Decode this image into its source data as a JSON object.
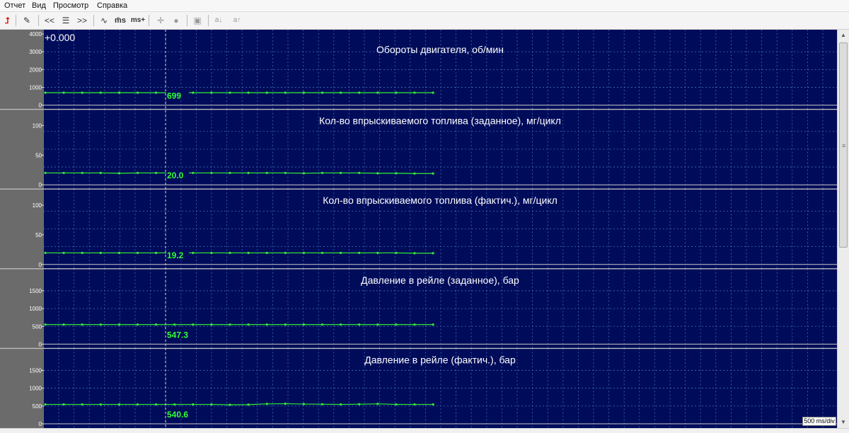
{
  "menu": {
    "items": [
      "Отчет",
      "Вид",
      "Просмотр",
      "Справка"
    ]
  },
  "toolbar": {
    "buttons": [
      {
        "icon": "red-up-arrow-icon",
        "glyph": "⮥",
        "color": "#e01010"
      },
      {
        "icon": "edit-icon",
        "glyph": "✎"
      },
      {
        "icon": "prev-icon",
        "glyph": "<<"
      },
      {
        "icon": "list-icon",
        "glyph": "☰"
      },
      {
        "icon": "next-icon",
        "glyph": ">>"
      },
      {
        "icon": "wave-icon",
        "glyph": "∿"
      },
      {
        "icon": "ms-minus-icon",
        "glyph": "m̄s"
      },
      {
        "icon": "ms-plus-icon",
        "glyph": "ms+"
      },
      {
        "icon": "cursor-add-icon",
        "glyph": "✛"
      },
      {
        "icon": "record-icon",
        "glyph": "●"
      },
      {
        "icon": "save-icon",
        "glyph": "▣"
      },
      {
        "icon": "a-down-icon",
        "glyph": "a↓"
      },
      {
        "icon": "a-up-icon",
        "glyph": "a↑"
      }
    ]
  },
  "time_offset": "+0.000",
  "scale_label": "500 ms/div",
  "colors": {
    "plot_bg": "#000c5a",
    "axis_bg": "#6b6b6b",
    "grid": "#3f6ab8",
    "trace": "#33ee33",
    "cursor": "#e8e08a",
    "value_text": "#33ff33",
    "title_text": "#ffffff",
    "separator": "#bcbcbc"
  },
  "chart_data": [
    {
      "type": "line",
      "title": "Обороты двигателя, об/мин",
      "ylim": [
        0,
        4000
      ],
      "yticks": [
        0,
        1000,
        2000,
        3000,
        4000
      ],
      "cursor_value": "699",
      "x_points": 22,
      "values": [
        699,
        699,
        699,
        699,
        699,
        699,
        699,
        699,
        699,
        699,
        699,
        699,
        699,
        699,
        699,
        699,
        699,
        699,
        699,
        699,
        699,
        699
      ]
    },
    {
      "type": "line",
      "title": "Кол-во впрыскиваемого топлива (заданное), мг/цикл",
      "ylim": [
        0,
        120
      ],
      "yticks": [
        0,
        50,
        100
      ],
      "cursor_value": "20.0",
      "x_points": 22,
      "values": [
        20,
        20,
        20,
        20,
        19.5,
        20,
        20,
        20,
        20,
        20,
        20,
        20,
        20,
        20,
        19.5,
        20,
        20,
        20,
        19.5,
        19.5,
        19,
        19
      ]
    },
    {
      "type": "line",
      "title": "Кол-во впрыскиваемого топлива (фактич.), мг/цикл",
      "ylim": [
        0,
        120
      ],
      "yticks": [
        0,
        50,
        100
      ],
      "cursor_value": "19.2",
      "x_points": 22,
      "values": [
        19.5,
        19.5,
        19.5,
        19.5,
        19.5,
        19.5,
        19.5,
        19.5,
        19.5,
        19.5,
        19.5,
        19.5,
        19.5,
        19.5,
        19.5,
        19.5,
        19.5,
        19.5,
        19.5,
        19.5,
        19,
        19
      ]
    },
    {
      "type": "line",
      "title": "Давление в рейле (заданное), бар",
      "ylim": [
        0,
        2000
      ],
      "yticks": [
        0,
        500,
        1000,
        1500
      ],
      "cursor_value": "547.3",
      "x_points": 22,
      "values": [
        550,
        550,
        550,
        550,
        550,
        550,
        550,
        550,
        550,
        550,
        550,
        550,
        550,
        550,
        550,
        550,
        550,
        550,
        550,
        550,
        550,
        550
      ]
    },
    {
      "type": "line",
      "title": "Давление в рейле (фактич.), бар",
      "ylim": [
        0,
        2000
      ],
      "yticks": [
        0,
        500,
        1000,
        1500
      ],
      "cursor_value": "540.6",
      "x_points": 22,
      "values": [
        545,
        545,
        545,
        545,
        545,
        545,
        545,
        545,
        545,
        545,
        535,
        540,
        560,
        565,
        555,
        550,
        545,
        550,
        560,
        545,
        545,
        545
      ]
    }
  ]
}
